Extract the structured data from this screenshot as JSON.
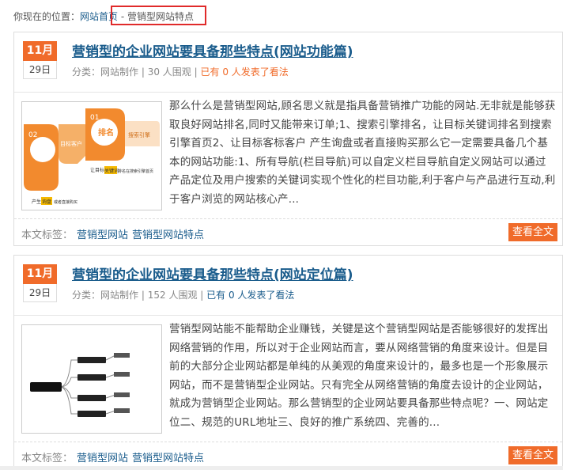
{
  "breadcrumb": {
    "prefix": "你现在的位置：",
    "home": "网站首页",
    "separator": " - ",
    "current": "营销型网站特点"
  },
  "posts": [
    {
      "month": "11月",
      "day": "29日",
      "title": "营销型的企业网站要具备那些特点(网站功能篇)",
      "category_label": "分类：",
      "category": "网站制作",
      "views": "30 人围观",
      "comments": "已有 0 人发表了看法",
      "excerpt": "那么什么是营销型网站,顾名思义就是指具备营销推广功能的网站.无非就是能够获取良好网站排名,同时又能带来订单;1、搜索引擎排名，让目标关键词排名到搜索引擎首页2、让目标客标客户 产生询盘或者直接购买那么它一定需要具备几个基本的网站功能:1、所有导航(栏目导航)可以自定义栏目导航自定义网站可以通过产品定位及用户搜索的关键词实现个性化的栏目功能,利于客户与产品进行互动,利于客户浏览的网站核心产...",
      "thumb_text": [
        "目标客户",
        "排名",
        "01",
        "02",
        "搜索引擎",
        "让目标",
        "关键词",
        "排名在搜索引擎首页",
        "产生",
        "询盘",
        "或者直接购买"
      ],
      "tags_label": "本文标签：",
      "tags": [
        "营销型网站",
        "营销型网站特点"
      ],
      "more": "查看全文"
    },
    {
      "month": "11月",
      "day": "29日",
      "title": "营销型的企业网站要具备那些特点(网站定位篇)",
      "category_label": "分类：",
      "category": "网站制作",
      "views": "152 人围观",
      "comments": "已有 0 人发表了看法",
      "excerpt": "营销型网站能不能帮助企业赚钱，关键是这个营销型网站是否能够很好的发挥出网络营销的作用，所以对于企业网站而言，要从网络营销的角度来设计。但是目前的大部分企业网站都是单纯的从美观的角度来设计的，最多也是一个形象展示网站，而不是营销型企业网站。只有完全从网络营销的角度去设计的企业网站，就成为营销型企业网站。那么营销型的企业网站要具备那些特点呢？一、网站定位二、规范的URL地址三、良好的推广系统四、完善的...",
      "tags_label": "本文标签：",
      "tags": [
        "营销型网站",
        "营销型网站特点"
      ],
      "more": "查看全文"
    }
  ],
  "colors": {
    "accent": "#f06b2a",
    "link": "#1a5c8c",
    "highlight_box": "#e02a2a"
  }
}
